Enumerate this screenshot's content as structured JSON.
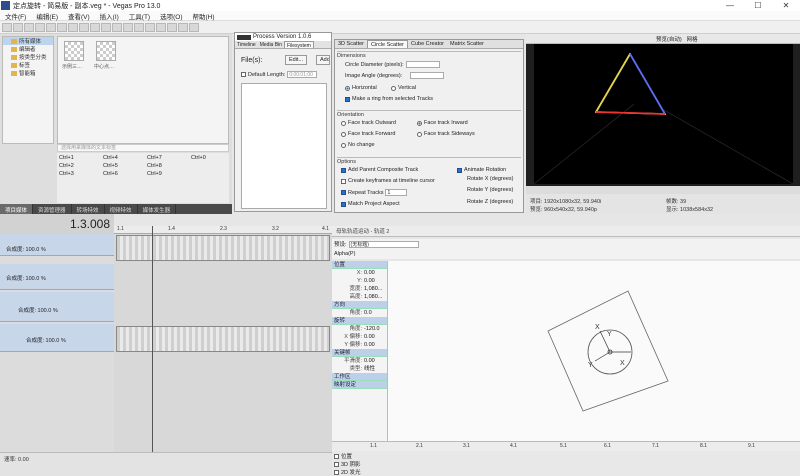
{
  "window": {
    "title": "定点旋转 - 简易版 - 副本.veg * - Vegas Pro 13.0",
    "min": "—",
    "max": "☐",
    "close": "✕"
  },
  "menu": [
    "文件(F)",
    "编辑(E)",
    "查看(V)",
    "插入(I)",
    "工具(T)",
    "选项(O)",
    "帮助(H)"
  ],
  "explorer": {
    "tree": [
      "所有媒体",
      "编辑者",
      "按类型分类",
      "标签",
      "智能箱"
    ],
    "thumbs": [
      "示例三…",
      "中心点…"
    ],
    "search_placeholder": "选择用来媒体的文本标签",
    "shortcuts": [
      "Ctrl+1",
      "Ctrl+2",
      "Ctrl+3",
      "Ctrl+4",
      "Ctrl+5",
      "Ctrl+6",
      "Ctrl+7",
      "Ctrl+8",
      "Ctrl+9",
      "Ctrl+0"
    ],
    "tabs": [
      "项目媒体",
      "资源管理器",
      "转场特效",
      "视频特效",
      "媒体发生器"
    ]
  },
  "process": {
    "title": "Process  Version 1.0.6",
    "tabs": [
      "Timeline",
      "Media Bin",
      "Filesystem"
    ],
    "files_label": "File(s):",
    "edit_btn": "Edit...",
    "add_btn": "Add",
    "default_length": "Default Length:",
    "default_length_value": "0;00:01;00"
  },
  "scatter": {
    "tabs": [
      "3D Scatter",
      "Circle Scatter",
      "Cube Creator",
      "Matrix Scatter"
    ],
    "dimensions": "Dimensions",
    "circle_diameter": "Circle Diameter (pixels):",
    "image_angle": "Image Angle (degrees):",
    "horizontal": "Horizontal",
    "vertical": "Vertical",
    "make_ring": "Make a ring from selected Tracks",
    "orientation": "Orientation",
    "face_outward": "Face track Outward",
    "face_inward": "Face track Inward",
    "face_forward": "Face track Forward",
    "face_sideways": "Face track Sideways",
    "no_change": "No change",
    "options": "Options",
    "add_parent": "Add Parent Composite Track",
    "animate_rotation": "Animate Rotation",
    "create_keyframes": "Create keyframes at timeline cursor",
    "rotate_x": "Rotate X (degrees)",
    "rotate_y": "Rotate Y (degrees)",
    "rotate_z": "Rotate Z (degrees)",
    "repeat_tracks": "Repeat Tracks",
    "repeat_value": "1",
    "match_aspect": "Match Project Aspect"
  },
  "preview": {
    "mode_label": "预览(自动)",
    "grid_label": "网格",
    "project": "项目: 1920x1080x32, 59.940i",
    "preview_size": "预览: 960x540x32, 59.940p",
    "frame": "帧数: 39",
    "display": "显示: 1038x584x32"
  },
  "timeline": {
    "timecode": "1.3.008",
    "ruler": [
      "1.1",
      "1.4",
      "2.3",
      "3.2",
      "4.1"
    ],
    "tracks": [
      {
        "level": "合成度: 100.0 %"
      },
      {
        "level": "合成度: 100.0 %"
      },
      {
        "level": "合成度: 100.0 %"
      },
      {
        "level": "合成度: 100.0 %"
      }
    ],
    "rate": "速率: 0.00"
  },
  "pancrop": {
    "header": "母轨轨道运动 - 轨道 2",
    "preset_label": "预设:",
    "preset_value": "(无标题)",
    "alpha_label": "Alpha(P)",
    "groups": [
      {
        "name": "位置",
        "rows": [
          [
            "X:",
            "0.00"
          ],
          [
            "Y:",
            "0.00"
          ],
          [
            "宽度:",
            "1,080..."
          ],
          [
            "高度:",
            "1,080..."
          ]
        ]
      },
      {
        "name": "方向",
        "rows": [
          [
            "角度:",
            "0.0"
          ]
        ]
      },
      {
        "name": "旋转",
        "rows": [
          [
            "角度:",
            "-120.0"
          ],
          [
            "X 偏移:",
            "0.00"
          ],
          [
            "Y 偏移:",
            "0.00"
          ]
        ]
      },
      {
        "name": "关键帧",
        "rows": [
          [
            "平滑度:",
            "0.00"
          ],
          [
            "类型:",
            "线性"
          ]
        ]
      },
      {
        "name": "工作区",
        "rows": []
      },
      {
        "name": "映射设定",
        "rows": []
      }
    ],
    "ruler": [
      "1.1",
      "2.1",
      "3.1",
      "4.1",
      "5.1",
      "6.1",
      "7.1",
      "8.1",
      "9.1"
    ],
    "kf_rows": [
      "位置",
      "3D 阴影",
      "2D 发光"
    ]
  }
}
